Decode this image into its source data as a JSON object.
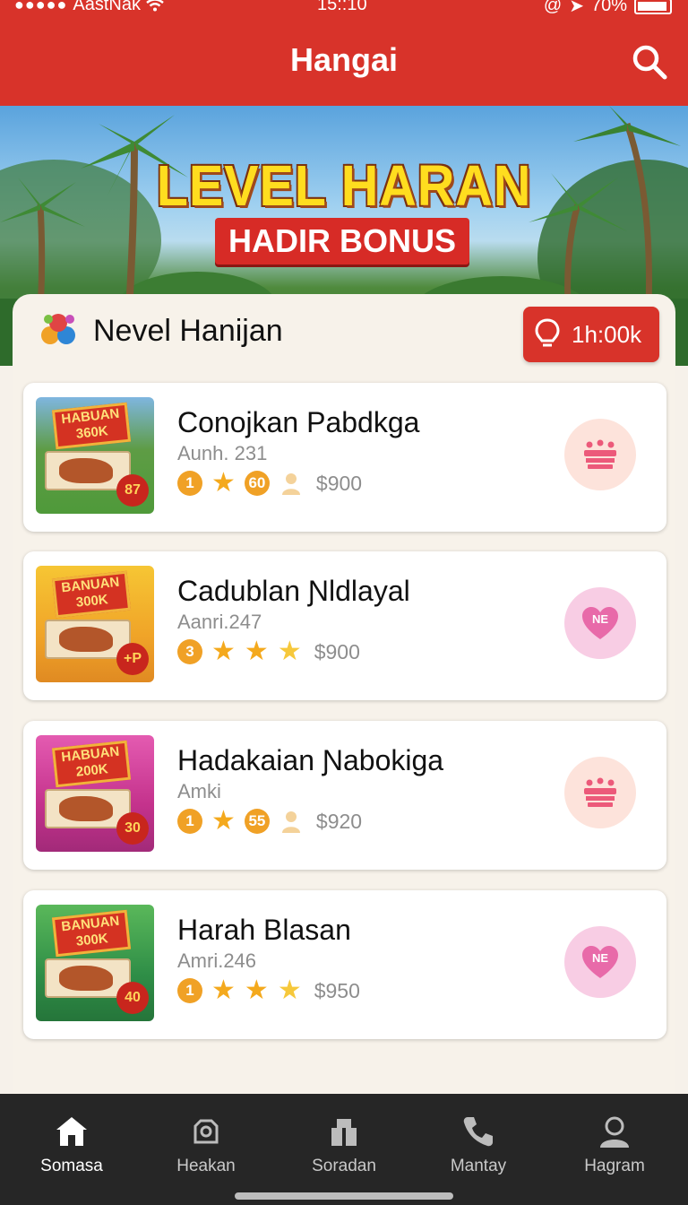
{
  "status_bar": {
    "carrier": "AastNak",
    "time": "15::10",
    "battery": "70%"
  },
  "header": {
    "title": "Hangai"
  },
  "banner": {
    "headline": "LEVEL HARAN",
    "subline": "HADIR BONUS"
  },
  "section": {
    "title": "Nevel Hanijan",
    "timer_label": "1h:00k"
  },
  "items": [
    {
      "title": "Conojkan Pabdkga",
      "subtitle": "Aunh. 231",
      "rank": "1",
      "price": "$900",
      "thumb_tag": "HABUAN 360K",
      "thumb_badge": "87",
      "thumb_color": "#4f9a3a"
    },
    {
      "title": "Cadublan Ɲldlayal",
      "subtitle": "Aanri.247",
      "rank": "3",
      "price": "$900",
      "thumb_tag": "BANUAN 300K",
      "thumb_badge": "+P",
      "thumb_color": "#f0a428"
    },
    {
      "title": "Hadakaian Ɲabokiga",
      "subtitle": "Amki",
      "rank": "1",
      "price": "$920",
      "thumb_tag": "HABUAN 200K",
      "thumb_badge": "30",
      "thumb_color": "#c4328c"
    },
    {
      "title": "Harah Blasan",
      "subtitle": "Amri.246",
      "rank": "1",
      "price": "$950",
      "thumb_tag": "BANUAN 300K",
      "thumb_badge": "40",
      "thumb_color": "#2f8e47"
    }
  ],
  "bottom_nav": [
    {
      "label": "Somasa",
      "icon": "home-icon"
    },
    {
      "label": "Heakan",
      "icon": "camera-icon"
    },
    {
      "label": "Soradan",
      "icon": "store-icon"
    },
    {
      "label": "Mantay",
      "icon": "phone-icon"
    },
    {
      "label": "Hagram",
      "icon": "user-icon"
    }
  ],
  "colors": {
    "brand_red": "#d8332a",
    "star": "#f4a91d",
    "nav_bg": "#262626"
  }
}
